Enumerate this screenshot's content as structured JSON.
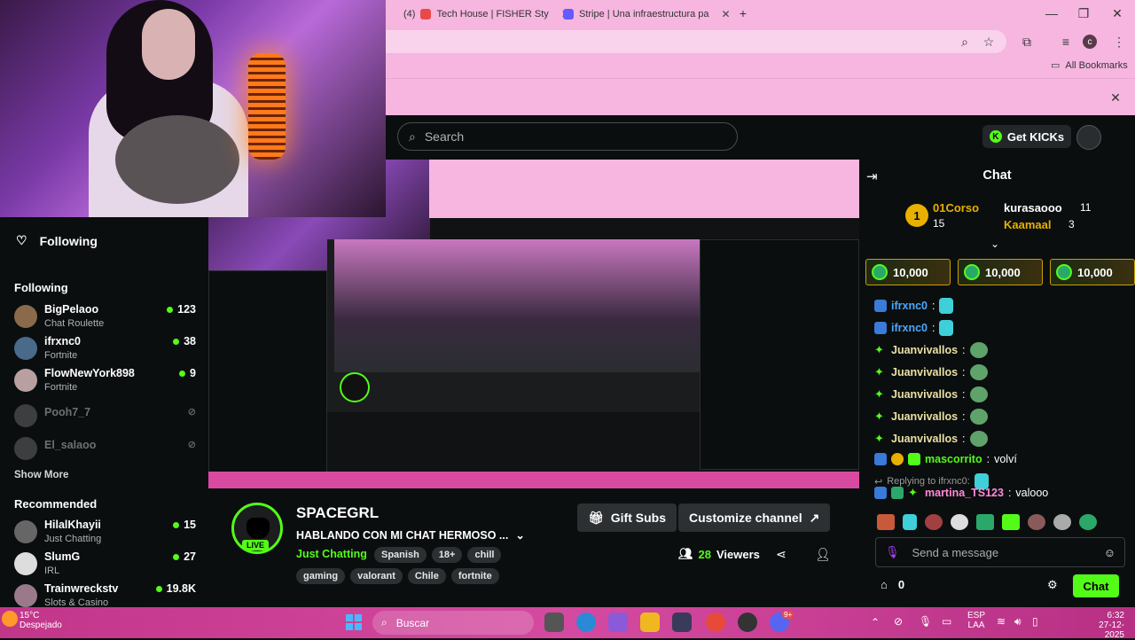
{
  "browser": {
    "tabs": [
      {
        "count": "(4)",
        "title": "Tech House | FISHER Sty"
      },
      {
        "title": "Stripe | Una infraestructura pa"
      }
    ],
    "bookmarks_label": "All Bookmarks",
    "profile_initial": "c"
  },
  "header": {
    "search_placeholder": "Search",
    "get_kicks": "Get KICKs"
  },
  "sidebar": {
    "following_nav": "Following",
    "following_heading": "Following",
    "following": [
      {
        "name": "BigPelaoo",
        "category": "Chat Roulette",
        "viewers": "123",
        "live": true
      },
      {
        "name": "ifrxnc0",
        "category": "Fortnite",
        "viewers": "38",
        "live": true
      },
      {
        "name": "FlowNewYork898",
        "category": "Fortnite",
        "viewers": "9",
        "live": true
      },
      {
        "name": "Pooh7_7",
        "category": "",
        "viewers": "",
        "live": false
      },
      {
        "name": "El_salaoo",
        "category": "",
        "viewers": "",
        "live": false
      }
    ],
    "show_more": "Show More",
    "recommended_heading": "Recommended",
    "recommended": [
      {
        "name": "HilalKhayii",
        "category": "Just Chatting",
        "viewers": "15"
      },
      {
        "name": "SlumG",
        "category": "IRL",
        "viewers": "27"
      },
      {
        "name": "Trainwreckstv",
        "category": "Slots & Casino",
        "viewers": "19.8K"
      }
    ]
  },
  "channel": {
    "streamer": "SPACEGRL",
    "live_label": "LIVE",
    "title": "HABLANDO CON MI CHAT HERMOSO ...",
    "category": "Just Chatting",
    "tags_row1": [
      "Spanish",
      "18+",
      "chill"
    ],
    "tags_row2": [
      "gaming",
      "valorant",
      "Chile",
      "fortnite"
    ],
    "gift_subs": "Gift Subs",
    "customize": "Customize channel",
    "viewers": "28",
    "viewers_label": "Viewers"
  },
  "chat": {
    "title": "Chat",
    "leaders": {
      "first": {
        "name": "01Corso",
        "rank": "1",
        "count": "15"
      },
      "second": {
        "name": "kurasaooo",
        "count": "11"
      },
      "third": {
        "name": "Kaamaal",
        "count": "3"
      }
    },
    "gift_cards": [
      "10,000",
      "10,000",
      "10,000"
    ],
    "messages": [
      {
        "user": "ifrxnc0",
        "text": ""
      },
      {
        "user": "ifrxnc0",
        "text": ""
      },
      {
        "user": "Juanvivallos",
        "text": ""
      },
      {
        "user": "Juanvivallos",
        "text": ""
      },
      {
        "user": "Juanvivallos",
        "text": ""
      },
      {
        "user": "Juanvivallos",
        "text": ""
      },
      {
        "user": "Juanvivallos",
        "text": ""
      },
      {
        "user": "mascorrito",
        "text": "volví"
      }
    ],
    "reply_to": "Replying to ifrxnc0:",
    "reply_user": "martina_TS123",
    "reply_text": "valooo",
    "send_placeholder": "Send a message",
    "points": "0",
    "chat_button": "Chat"
  },
  "taskbar": {
    "temp": "15°C",
    "weather": "Despejado",
    "search": "Buscar",
    "lang1": "ESP",
    "lang2": "LAA",
    "time": "6:32",
    "date": "27-12-2025",
    "discord_badge": "9+"
  },
  "colors": {
    "accent": "#53fc18",
    "chrome": "#f6b6e0",
    "bg": "#0b0e0f"
  }
}
